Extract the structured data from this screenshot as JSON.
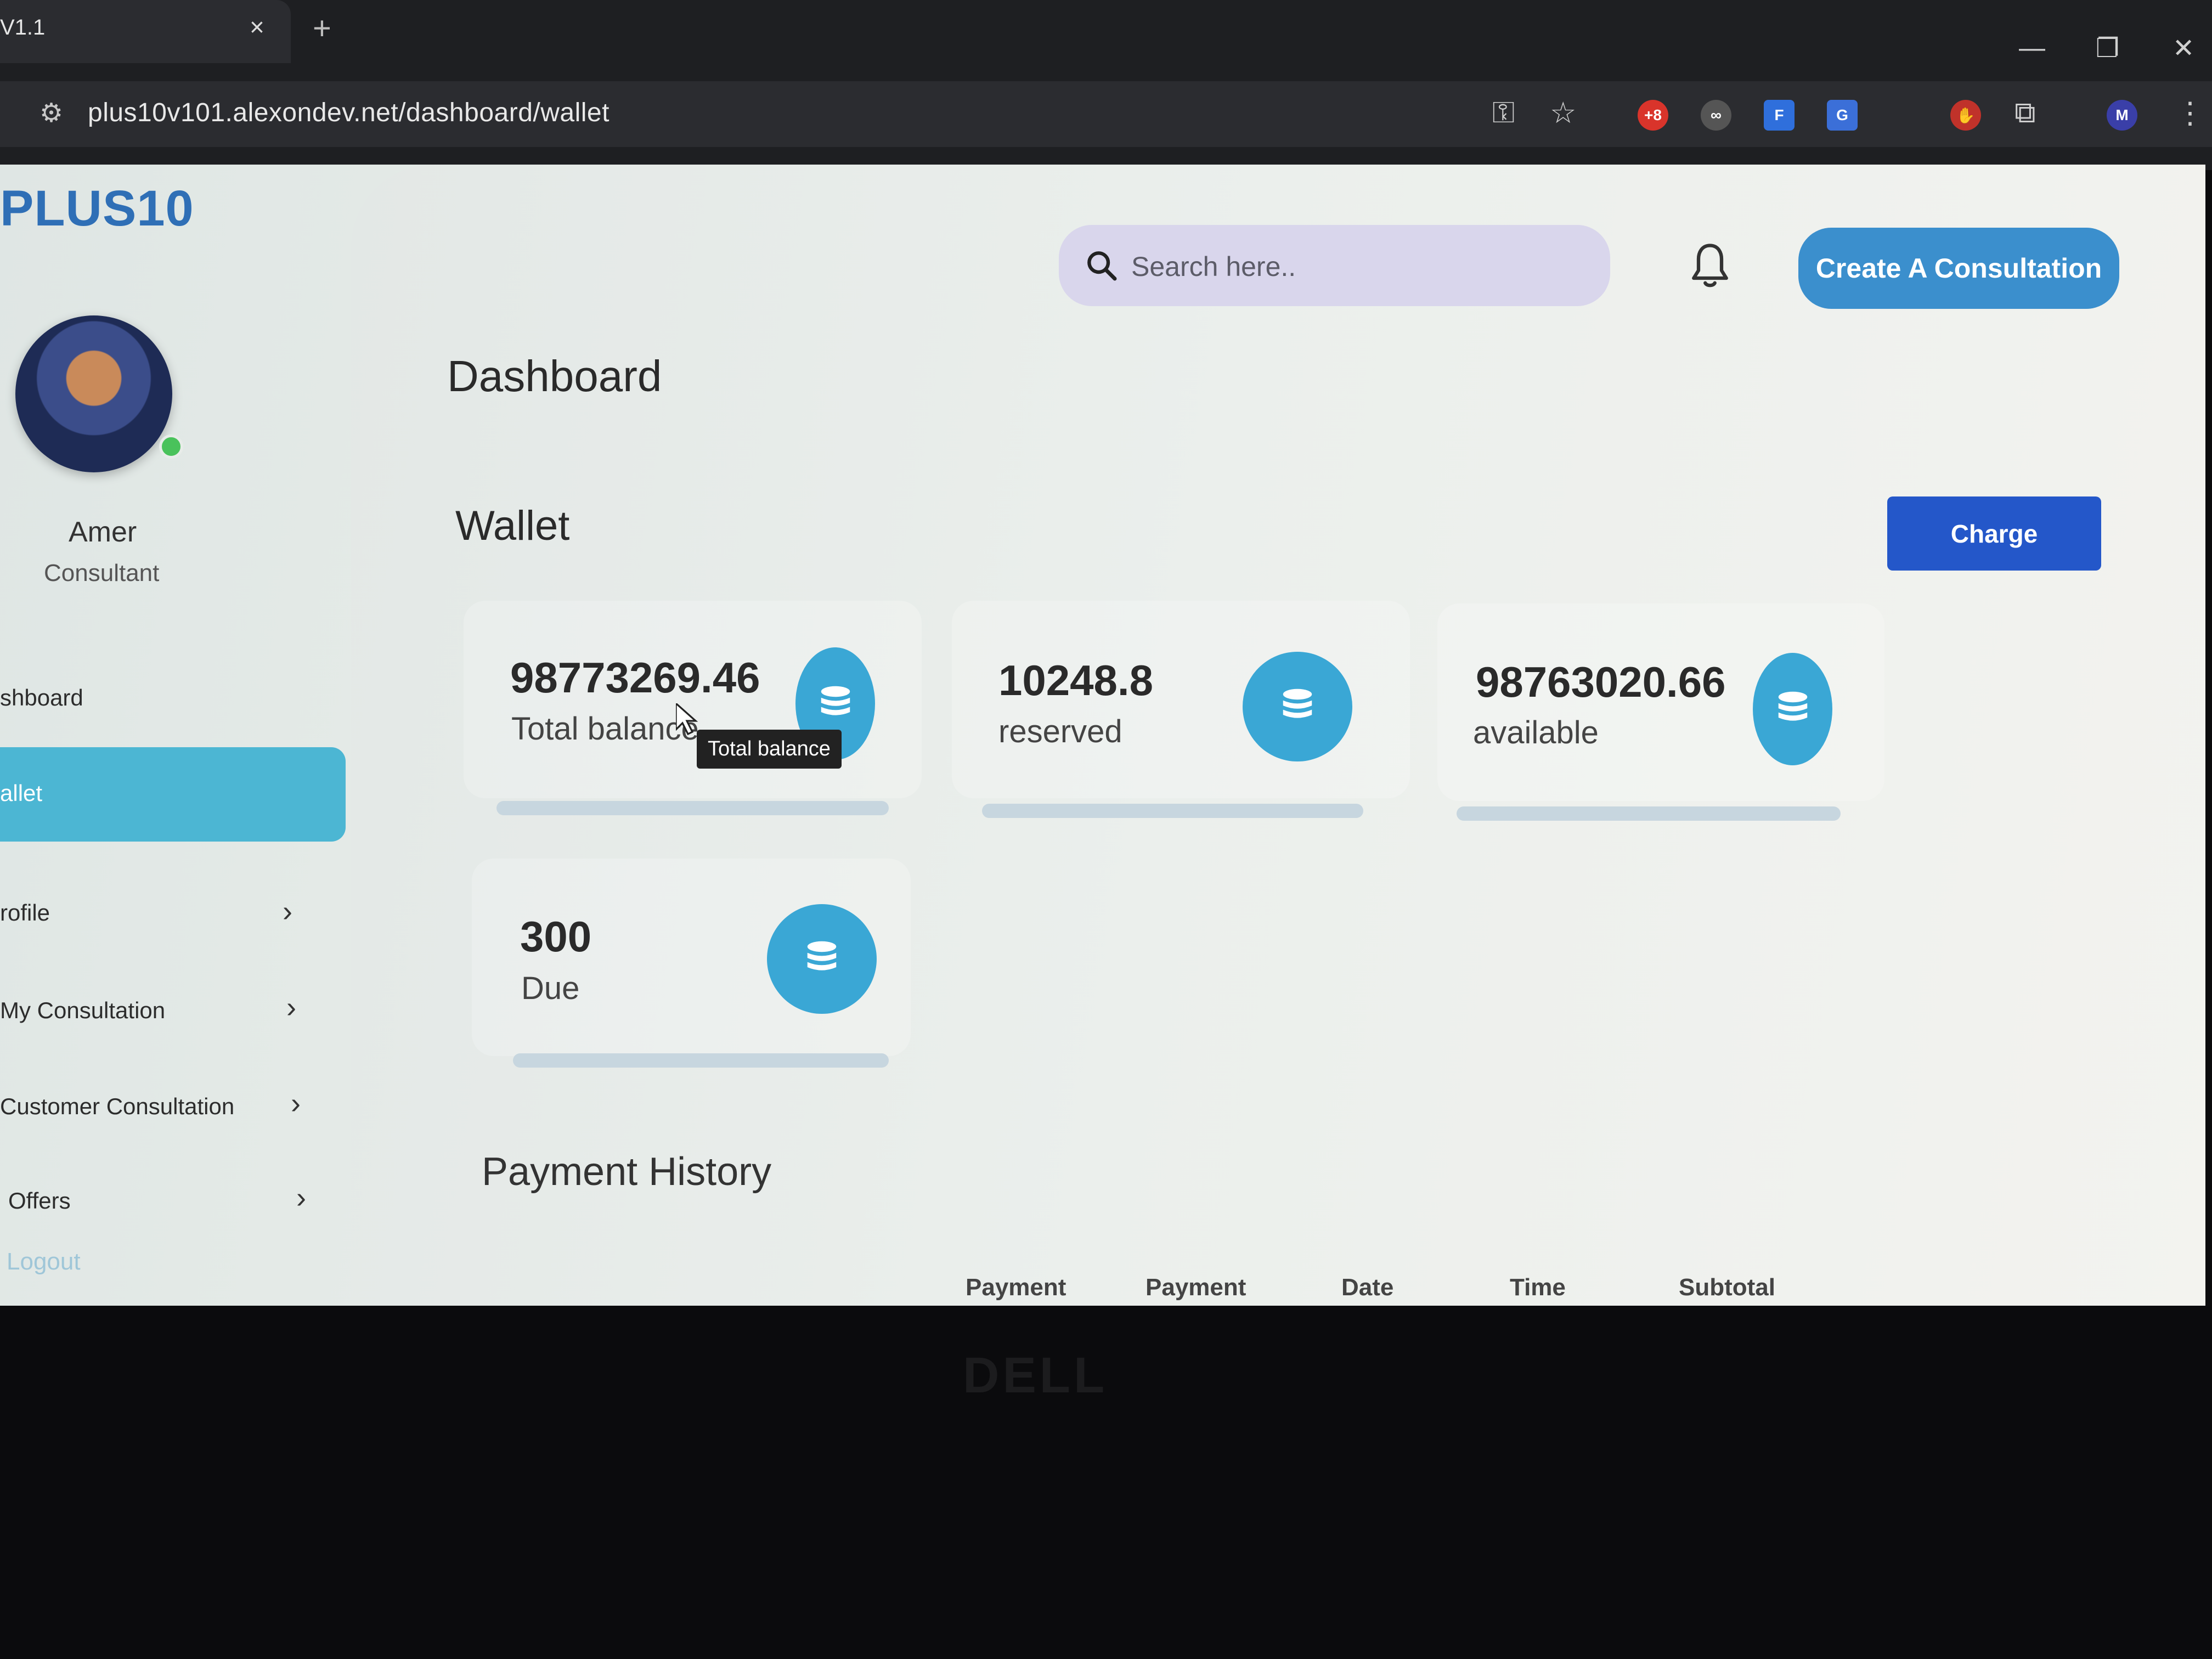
{
  "browser": {
    "tab_title": "V1.1",
    "tab_close": "×",
    "new_tab": "+",
    "url": "plus10v101.alexondev.net/dashboard/wallet",
    "profile_initial": "M"
  },
  "sidebar": {
    "logo": "PLUS10",
    "user_name": "Amer",
    "user_role": "Consultant",
    "items": [
      {
        "label": "shboard"
      },
      {
        "label": "allet"
      },
      {
        "label": "rofile"
      },
      {
        "label": "My Consultation"
      },
      {
        "label": "Customer Consultation"
      },
      {
        "label": "Offers"
      }
    ],
    "logout": "Logout"
  },
  "header": {
    "search_placeholder": "Search here..",
    "create_button": "Create A Consultation"
  },
  "main": {
    "page_title": "Dashboard",
    "section_title": "Wallet",
    "charge_button": "Charge",
    "cards": [
      {
        "value": "98773269.46",
        "label": "Total balance"
      },
      {
        "value": "10248.8",
        "label": "reserved"
      },
      {
        "value": "98763020.66",
        "label": "available"
      },
      {
        "value": "300",
        "label": "Due"
      }
    ],
    "tooltip": "Total balance",
    "history_title": "Payment History",
    "table_headers": [
      "Payment",
      "Payment",
      "Date",
      "Time",
      "Subtotal"
    ]
  },
  "device": {
    "brand": "DELL"
  },
  "colors": {
    "accent": "#3aa7d5",
    "active_nav": "#4cb6d3",
    "primary_button": "#3b8fcd",
    "charge_button": "#2457c9",
    "logo": "#2f6fb6"
  }
}
